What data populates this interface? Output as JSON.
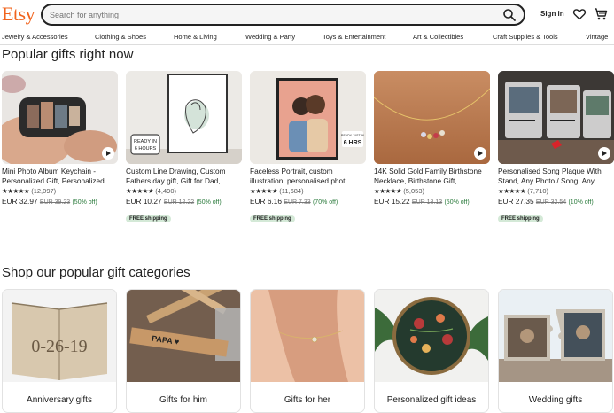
{
  "header": {
    "logo": "Etsy",
    "search_placeholder": "Search for anything",
    "signin": "Sign in"
  },
  "nav": [
    "Jewelry & Accessories",
    "Clothing & Shoes",
    "Home & Living",
    "Wedding & Party",
    "Toys & Entertainment",
    "Art & Collectibles",
    "Craft Supplies & Tools",
    "Vintage"
  ],
  "popular": {
    "title": "Popular gifts right now",
    "products": [
      {
        "title": "Mini Photo Album Keychain - Personalized Gift, Personalized...",
        "stars": "★★★★★",
        "count": "(12,097)",
        "price": "EUR 32.97",
        "was": "EUR 39.23",
        "off": "(50% off)",
        "badge": "",
        "video": true
      },
      {
        "title": "Custom Line Drawing, Custom Fathers day gift, Gift for Dad,...",
        "stars": "★★★★★",
        "count": "(4,490)",
        "price": "EUR 10.27",
        "was": "EUR 12.22",
        "off": "(50% off)",
        "badge": "FREE shipping",
        "video": false
      },
      {
        "title": "Faceless Portrait, custom illustration, personalised phot...",
        "stars": "★★★★★",
        "count": "(11,684)",
        "price": "EUR 6.16",
        "was": "EUR 7.33",
        "off": "(70% off)",
        "badge": "FREE shipping",
        "video": false
      },
      {
        "title": "14K Solid Gold Family Birthstone Necklace, Birthstone Gift,...",
        "stars": "★★★★★",
        "count": "(5,053)",
        "price": "EUR 15.22",
        "was": "EUR 18.13",
        "off": "(50% off)",
        "badge": "",
        "video": true
      },
      {
        "title": "Personalised Song Plaque With Stand, Any Photo / Song, Any...",
        "stars": "★★★★★",
        "count": "(7,710)",
        "price": "EUR 27.35",
        "was": "EUR 32.54",
        "off": "(10% off)",
        "badge": "FREE shipping",
        "video": true
      }
    ]
  },
  "categories": {
    "title": "Shop our popular gift categories",
    "items": [
      {
        "label": "Anniversary gifts"
      },
      {
        "label": "Gifts for him"
      },
      {
        "label": "Gifts for her"
      },
      {
        "label": "Personalized gift ideas"
      },
      {
        "label": "Wedding gifts"
      }
    ]
  },
  "image_text": {
    "ready_sign": "READY IN\n6 HOURS",
    "ready_line1": "READY IN",
    "ready_line2": "6 HOURS",
    "ready_just": "READY JUST IN",
    "ready_hours": "6 HRS",
    "book_fold": "0-26-19",
    "papa_tag": "PAPA ♥"
  },
  "colors": {
    "brand": "#f1641e",
    "discount": "#2a7a3b",
    "badge_bg": "#d4e9d7"
  }
}
